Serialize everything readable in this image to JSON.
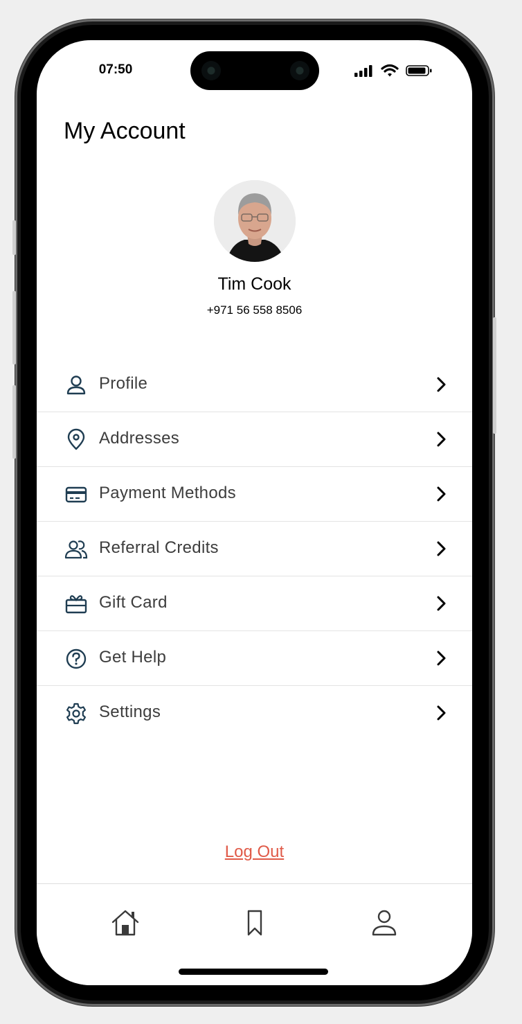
{
  "status_bar": {
    "time": "07:50"
  },
  "header": {
    "title": "My Account"
  },
  "user": {
    "name": "Tim Cook",
    "phone": "+971 56 558 8506"
  },
  "menu": [
    {
      "label": "Profile",
      "icon": "person-icon"
    },
    {
      "label": "Addresses",
      "icon": "location-pin-icon"
    },
    {
      "label": "Payment Methods",
      "icon": "credit-card-icon"
    },
    {
      "label": "Referral Credits",
      "icon": "users-icon"
    },
    {
      "label": "Gift Card",
      "icon": "gift-card-icon"
    },
    {
      "label": "Get Help",
      "icon": "help-icon"
    },
    {
      "label": "Settings",
      "icon": "gear-icon"
    }
  ],
  "logout_label": "Log Out",
  "tabbar": [
    {
      "icon": "home-icon"
    },
    {
      "icon": "bookmark-icon"
    },
    {
      "icon": "profile-icon"
    }
  ],
  "colors": {
    "icon": "#1f3d52",
    "logout": "#e05a48",
    "text": "#3d3d3d"
  }
}
